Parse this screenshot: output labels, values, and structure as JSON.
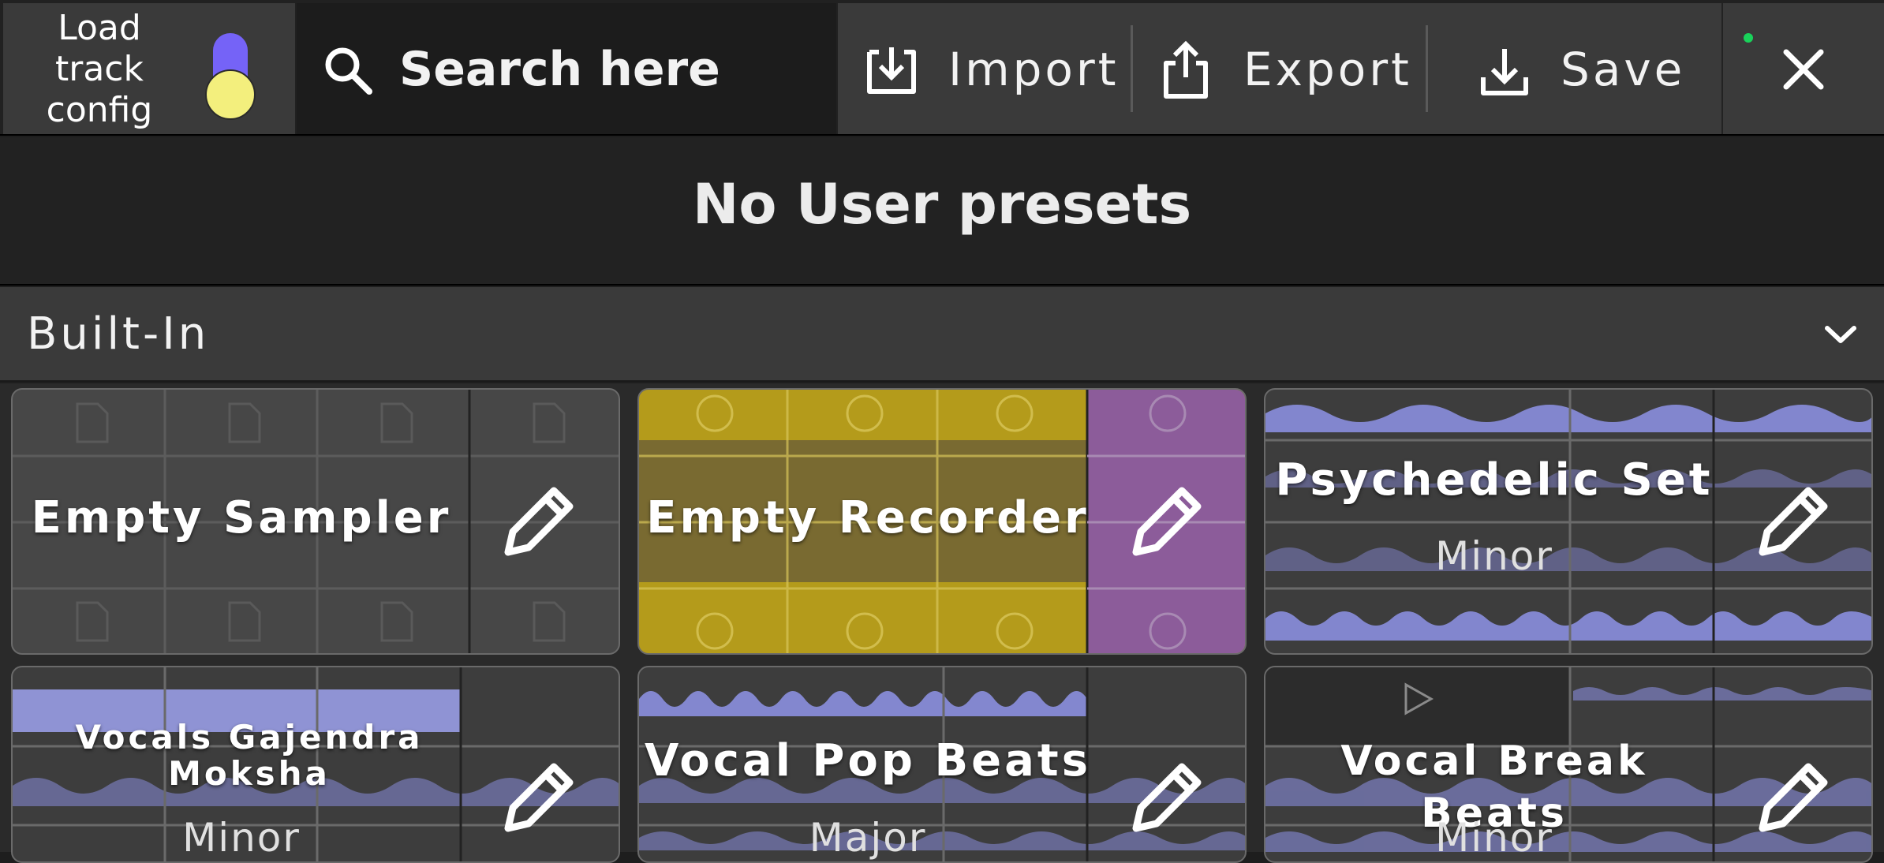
{
  "topbar": {
    "load_label_lines": [
      "Load",
      "track",
      "config"
    ],
    "toggle_state": "on",
    "search": {
      "placeholder": "Search here"
    },
    "import_label": "Import",
    "export_label": "Export",
    "save_label": "Save",
    "status_color": "#19d25a"
  },
  "user_presets": {
    "empty_text": "No User presets"
  },
  "builtin": {
    "label": "Built-In",
    "cards": [
      {
        "title": "Empty Sampler",
        "subtitle": ""
      },
      {
        "title": "Empty Recorder",
        "subtitle": ""
      },
      {
        "title": "Psychedelic Set",
        "subtitle": "Minor"
      },
      {
        "title": "Vocals Gajendra Moksha",
        "subtitle": "Minor"
      },
      {
        "title": "Vocal Pop Beats",
        "subtitle": "Major"
      },
      {
        "title": "Vocal Break Beats",
        "subtitle": "Minor"
      }
    ]
  },
  "colors": {
    "accent_purple": "#7563f7",
    "knob_yellow": "#f3ef7d",
    "recorder_yellow": "#b49b1b",
    "recorder_purple": "#8c5c9a",
    "waveform": "#8f94e9"
  }
}
